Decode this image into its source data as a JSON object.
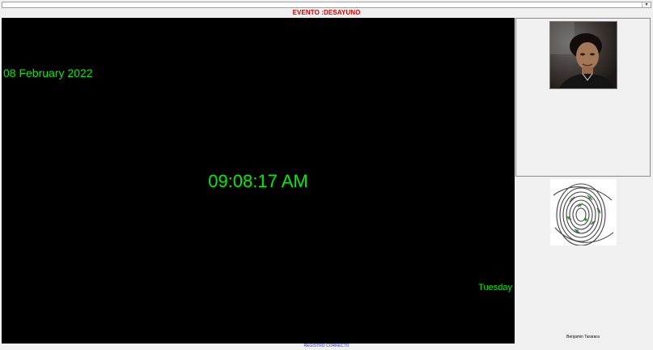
{
  "event": {
    "label": "EVENTO :DESAYUNO",
    "color": "#d40000"
  },
  "clock": {
    "date": "08 February 2022",
    "time": "09:08:17 AM",
    "day": "Tuesday",
    "text_color": "#00ee00",
    "background": "#000000"
  },
  "person": {
    "name": "Benjamin Tararara"
  },
  "status": {
    "message": "REGISTRO CORRECTO",
    "color": "#2a2ad0"
  },
  "icons": {
    "dropdown": "chevron-down-icon",
    "photo": "user-photo",
    "fingerprint": "fingerprint-image"
  }
}
